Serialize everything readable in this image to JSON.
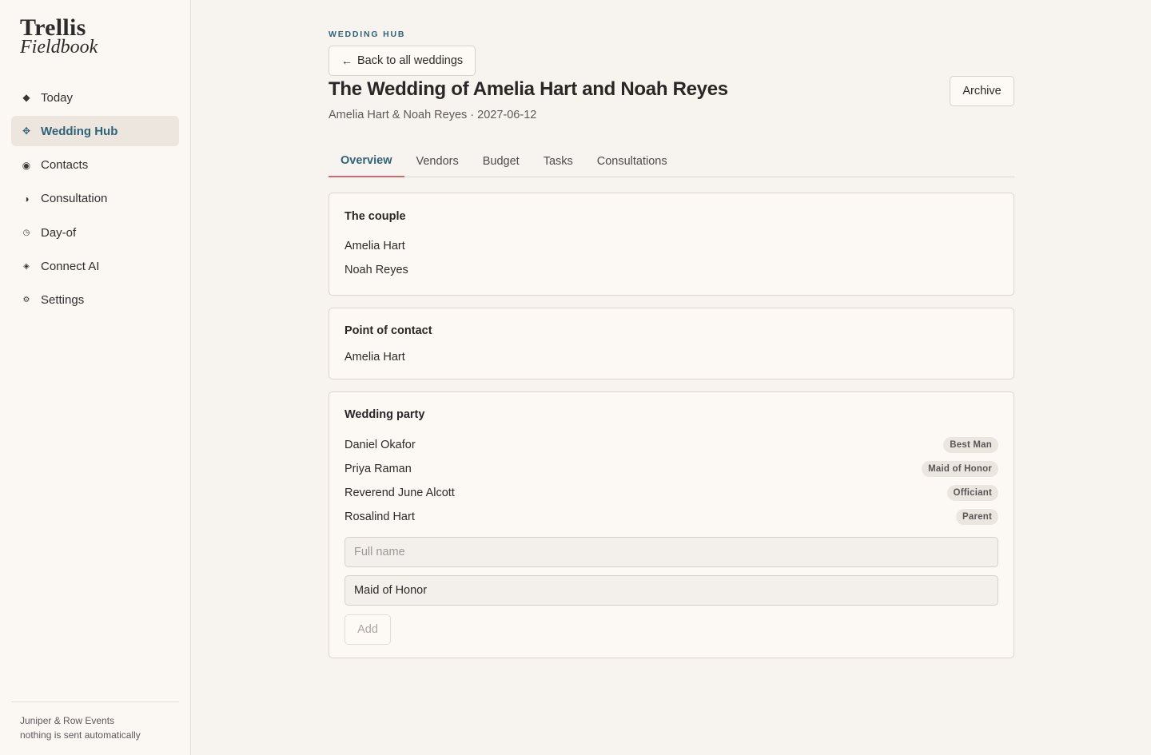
{
  "brand": {
    "line1": "Trellis",
    "line2": "Fieldbook"
  },
  "sidebar": {
    "items": [
      {
        "label": "Today",
        "icon": "diamond-icon",
        "active": false
      },
      {
        "label": "Wedding Hub",
        "icon": "sparkle-icon",
        "active": true
      },
      {
        "label": "Contacts",
        "icon": "circle-dot-icon",
        "active": false
      },
      {
        "label": "Consultation",
        "icon": "half-circle-icon",
        "active": false
      },
      {
        "label": "Day-of",
        "icon": "clock-icon",
        "active": false
      },
      {
        "label": "Connect AI",
        "icon": "diamond-dot-icon",
        "active": false
      },
      {
        "label": "Settings",
        "icon": "gear-icon",
        "active": false
      }
    ],
    "footer": {
      "org": "Juniper & Row Events",
      "note": "nothing is sent automatically"
    }
  },
  "header": {
    "eyebrow": "WEDDING HUB",
    "back_label": "Back to all weddings",
    "title": "The Wedding of Amelia Hart and Noah Reyes",
    "subtitle": "Amelia Hart & Noah Reyes · 2027-06-12",
    "archive_label": "Archive"
  },
  "tabs": [
    {
      "label": "Overview",
      "active": true
    },
    {
      "label": "Vendors",
      "active": false
    },
    {
      "label": "Budget",
      "active": false
    },
    {
      "label": "Tasks",
      "active": false
    },
    {
      "label": "Consultations",
      "active": false
    }
  ],
  "couple": {
    "title": "The couple",
    "names": [
      "Amelia Hart",
      "Noah Reyes"
    ]
  },
  "contact": {
    "title": "Point of contact",
    "name": "Amelia Hart"
  },
  "party": {
    "title": "Wedding party",
    "members": [
      {
        "name": "Daniel Okafor",
        "role": "Best Man"
      },
      {
        "name": "Priya Raman",
        "role": "Maid of Honor"
      },
      {
        "name": "Reverend June Alcott",
        "role": "Officiant"
      },
      {
        "name": "Rosalind Hart",
        "role": "Parent"
      }
    ],
    "name_placeholder": "Full name",
    "name_value": "",
    "role_value": "Maid of Honor",
    "add_label": "Add"
  },
  "colors": {
    "accent": "#2e6378",
    "tab_underline": "#c46b74",
    "background": "#f7f3ee"
  }
}
